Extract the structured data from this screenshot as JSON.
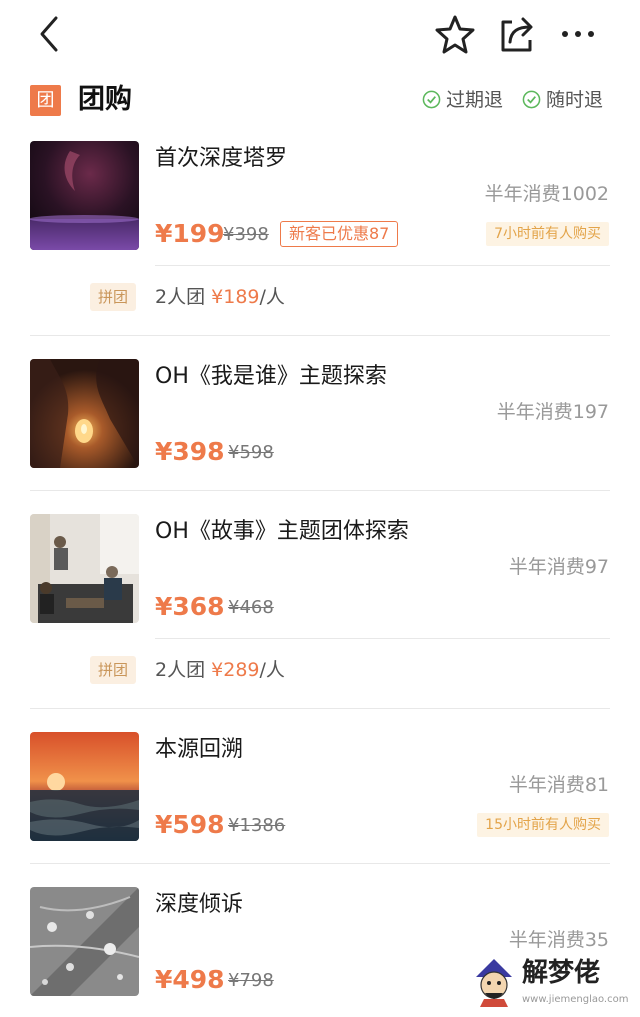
{
  "header": {
    "back_icon": "chevron-left-icon",
    "favorite_icon": "star-icon",
    "share_icon": "share-icon",
    "more_icon": "more-horizontal-icon"
  },
  "section": {
    "badge": "团",
    "title": "团购",
    "guarantees": [
      "过期退",
      "随时退"
    ],
    "accent_color": "#ee7a4a",
    "check_color": "#5cb85c"
  },
  "deals": [
    {
      "title": "首次深度塔罗",
      "sales": "半年消费1002",
      "price": "¥199",
      "original_price": "¥398",
      "promo": "新客已优惠87",
      "recent": "7小时前有人购买",
      "group": {
        "tag": "拼团",
        "label": "2人团",
        "price": "¥189",
        "unit": "/人"
      }
    },
    {
      "title": "OH《我是谁》主题探索",
      "sales": "半年消费197",
      "price": "¥398",
      "original_price": "¥598"
    },
    {
      "title": "OH《故事》主题团体探索",
      "sales": "半年消费97",
      "price": "¥368",
      "original_price": "¥468",
      "group": {
        "tag": "拼团",
        "label": "2人团",
        "price": "¥289",
        "unit": "/人"
      }
    },
    {
      "title": "本源回溯",
      "sales": "半年消费81",
      "price": "¥598",
      "original_price": "¥1386",
      "recent": "15小时前有人购买"
    },
    {
      "title": "深度倾诉",
      "sales": "半年消费35",
      "price": "¥498",
      "original_price": "¥798"
    }
  ],
  "watermark": {
    "name": "解梦佬",
    "url": "www.jiemenglao.com"
  }
}
